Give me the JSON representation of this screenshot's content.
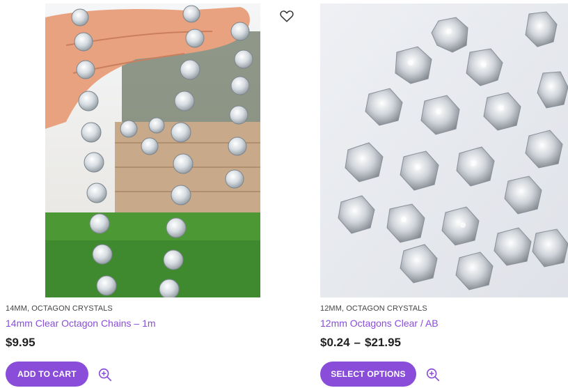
{
  "accent_color": "#8a4dd9",
  "products": [
    {
      "categories": [
        "14MM",
        "OCTAGON CRYSTALS"
      ],
      "title": "14mm Clear Octagon Chains – 1m",
      "price": "$9.95",
      "button_label": "ADD TO CART",
      "icons": {
        "wishlist": "heart-outline-icon",
        "quickview": "magnifier-plus-icon"
      }
    },
    {
      "categories": [
        "12MM",
        "OCTAGON CRYSTALS"
      ],
      "title": "12mm Octagons Clear / AB",
      "price_min": "$0.24",
      "price_separator": "–",
      "price_max": "$21.95",
      "button_label": "SELECT OPTIONS",
      "icons": {
        "quickview": "magnifier-plus-icon"
      }
    }
  ]
}
